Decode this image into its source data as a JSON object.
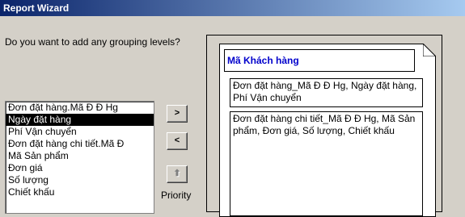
{
  "window": {
    "title": "Report Wizard"
  },
  "prompt": {
    "question": "Do you want to add any grouping levels?"
  },
  "field_list": {
    "items": [
      "Đơn đặt hàng.Mã Đ Đ Hg",
      "Ngày đặt hàng",
      "Phí Vận chuyển",
      "Đơn đặt hàng chi tiết.Mã Đ",
      "Mã Sản phẩm",
      "Đơn giá",
      "Số lượng",
      "Chiết khấu"
    ],
    "selected_index": 1
  },
  "buttons": {
    "add": ">",
    "remove": "<",
    "priority_up": "⬆",
    "priority_label": "Priority"
  },
  "preview": {
    "group_level_1": "Mã Khách hàng",
    "group_level_2": "Đơn đặt hàng_Mã Đ Đ Hg, Ngày đặt hàng, Phí Vận chuyển",
    "detail_fields": "Đơn đặt hàng chi tiết_Mã Đ Đ Hg, Mã Sản phẩm, Đơn giá, Số lượng, Chiết khấu"
  }
}
